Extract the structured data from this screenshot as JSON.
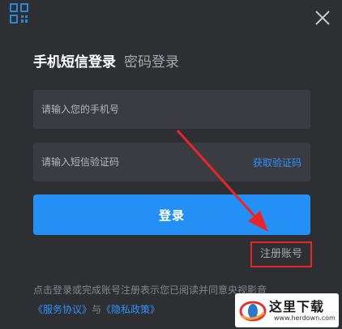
{
  "header": {
    "qr_icon": "qr-code-icon",
    "close_icon": "close-icon"
  },
  "tabs": [
    {
      "label": "手机短信登录",
      "active": true
    },
    {
      "label": "密码登录",
      "active": false
    }
  ],
  "form": {
    "phone_placeholder": "请输入您的手机号",
    "phone_value": "",
    "code_placeholder": "请输入短信验证码",
    "code_value": "",
    "get_code_label": "获取验证码",
    "login_label": "登录"
  },
  "register": {
    "label": "注册账号"
  },
  "agreement": {
    "text": "点击登录或完成账号注册表示您已阅读并同意央视影音",
    "service_link": "《服务协议》",
    "and": "与",
    "privacy_link": "《隐私政策》"
  },
  "watermark": {
    "title": "这里下载",
    "url": "www.herdown.com"
  },
  "colors": {
    "background": "#2e2f33",
    "input_background": "#3b3c41",
    "accent": "#2490f5",
    "link": "#2e91ff",
    "annotation": "#e8262a"
  }
}
